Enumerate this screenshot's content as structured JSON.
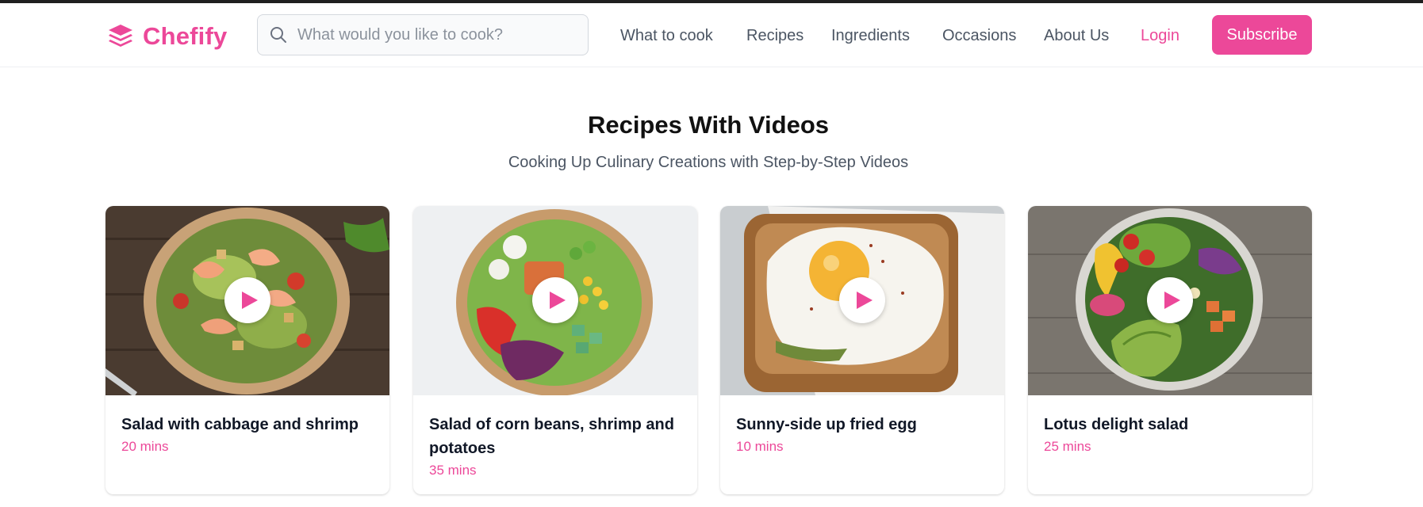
{
  "brand": {
    "name": "Chefify",
    "logo_icon": "layers-icon",
    "accent_color": "#ec4899"
  },
  "search": {
    "placeholder": "What would you like to cook?",
    "value": "",
    "icon": "search-icon"
  },
  "nav": {
    "links": [
      "What to cook",
      "Recipes",
      "Ingredients",
      "Occasions",
      "About Us"
    ],
    "login_label": "Login",
    "subscribe_label": "Subscribe"
  },
  "section": {
    "title": "Recipes With Videos",
    "subtitle": "Cooking Up Culinary Creations with Step-by-Step Videos"
  },
  "recipes": [
    {
      "title": "Salad with cabbage and shrimp",
      "time": "20 mins"
    },
    {
      "title": "Salad of corn beans, shrimp and potatoes",
      "time": "35 mins"
    },
    {
      "title": "Sunny-side up fried egg",
      "time": "10 mins"
    },
    {
      "title": "Lotus delight salad",
      "time": "25 mins"
    }
  ]
}
